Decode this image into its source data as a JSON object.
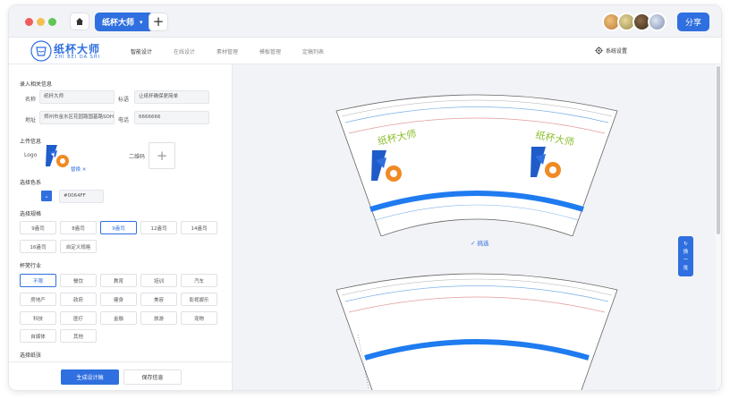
{
  "titlebar": {
    "tab_label": "纸杯大师",
    "share_label": "分享"
  },
  "nav": {
    "logo_name": "纸杯大师",
    "logo_pinyin": "ZHI BEI DA SHI",
    "items": [
      "智能设计",
      "在线设计",
      "素材管理",
      "模板管理",
      "定稿列表"
    ],
    "system_settings": "系统设置"
  },
  "form": {
    "info_title": "录入相关信息",
    "name_label": "名称",
    "name_value": "纸杯大师",
    "slogan_label": "标语",
    "slogan_value": "让纸杯确保更简单",
    "address_label": "地址",
    "address_value": "郑州市金水区花园路国基路SOHO(",
    "phone_label": "电话",
    "phone_value": "6666666",
    "upload_title": "上传信息",
    "logo_label": "Logo",
    "logo_actions": "替换 ✕",
    "qrcode_label": "二维码",
    "color_title": "选择色系",
    "color_hex": "#0064FF",
    "spec_title": "选择规格",
    "specs": [
      "9盎司",
      "8盎司",
      "9盎司",
      "12盎司",
      "14盎司",
      "16盎司",
      "自定义规格"
    ],
    "industry_title": "杯篼行业",
    "industries": [
      "不限",
      "餐饮",
      "教育",
      "培训",
      "汽车",
      "房地产",
      "政府",
      "健身",
      "美容",
      "影视娱乐",
      "科技",
      "医疗",
      "金融",
      "旅游",
      "宠物",
      "自媒体",
      "其他"
    ],
    "paper_title": "选择纸张",
    "generate_button": "生成设计稿",
    "save_button": "保存信息"
  },
  "canvas": {
    "cup_brand": "纸杯大师",
    "check_label": "✓  挑选",
    "float_tool": [
      "↻",
      "换",
      "一",
      "批"
    ]
  },
  "colors": {
    "primary": "#2F6FDF",
    "cup_band": "#1F7BF0",
    "cup_line_blue": "#7FB2E8",
    "cup_line_red": "#E59A9A"
  }
}
